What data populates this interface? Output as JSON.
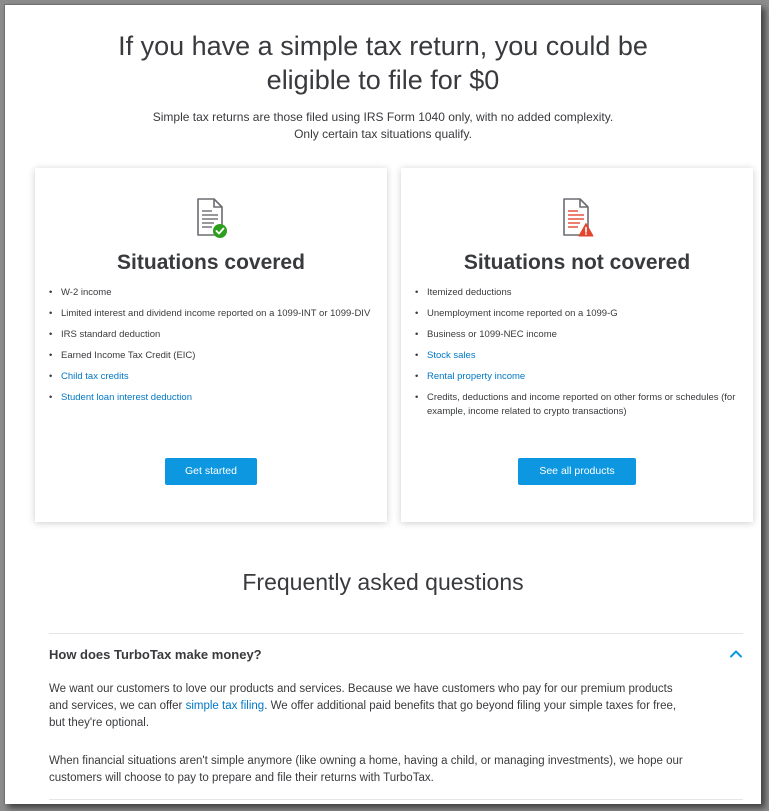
{
  "hero": {
    "title_line1": "If you have a simple tax return, you could be",
    "title_line2": "eligible to file for $0",
    "subtitle_line1": "Simple tax returns are those filed using IRS Form 1040 only, with no added complexity.",
    "subtitle_line2": "Only certain tax situations qualify."
  },
  "covered": {
    "icon": "document-check-icon",
    "title": "Situations covered",
    "items": [
      "W-2 income",
      "Limited interest and dividend income reported on a 1099-INT or 1099-DIV",
      "IRS standard deduction",
      "Earned Income Tax Credit (EIC)",
      "Child tax credits",
      "Student loan interest deduction"
    ],
    "button": "Get started"
  },
  "not_covered": {
    "icon": "document-warning-icon",
    "title": "Situations not covered",
    "items": [
      "Itemized deductions",
      "Unemployment income reported on a 1099-G",
      "Business or 1099-NEC income",
      "Stock sales",
      "Rental property income",
      "Credits, deductions and income reported on other forms or schedules (for example, income related to crypto transactions)"
    ],
    "button": "See all products"
  },
  "faq": {
    "title": "Frequently asked questions",
    "question": "How does TurboTax make money?",
    "answer1_part1": "We want our customers to love our products and services. Because we have customers who pay for our premium products and services, we can offer ",
    "answer1_link": "simple tax filing",
    "answer1_part2": ". We offer additional paid benefits that go beyond filing your simple taxes for free, but they're optional.",
    "answer2": "When financial situations aren't simple anymore (like owning a home, having a child, or managing investments), we hope our customers will choose to pay to prepare and file their returns with TurboTax."
  },
  "colors": {
    "accent": "#0d97e0",
    "link": "#0077c5",
    "text": "#393a3d",
    "check": "#2ca01c",
    "warning": "#e2462f"
  }
}
